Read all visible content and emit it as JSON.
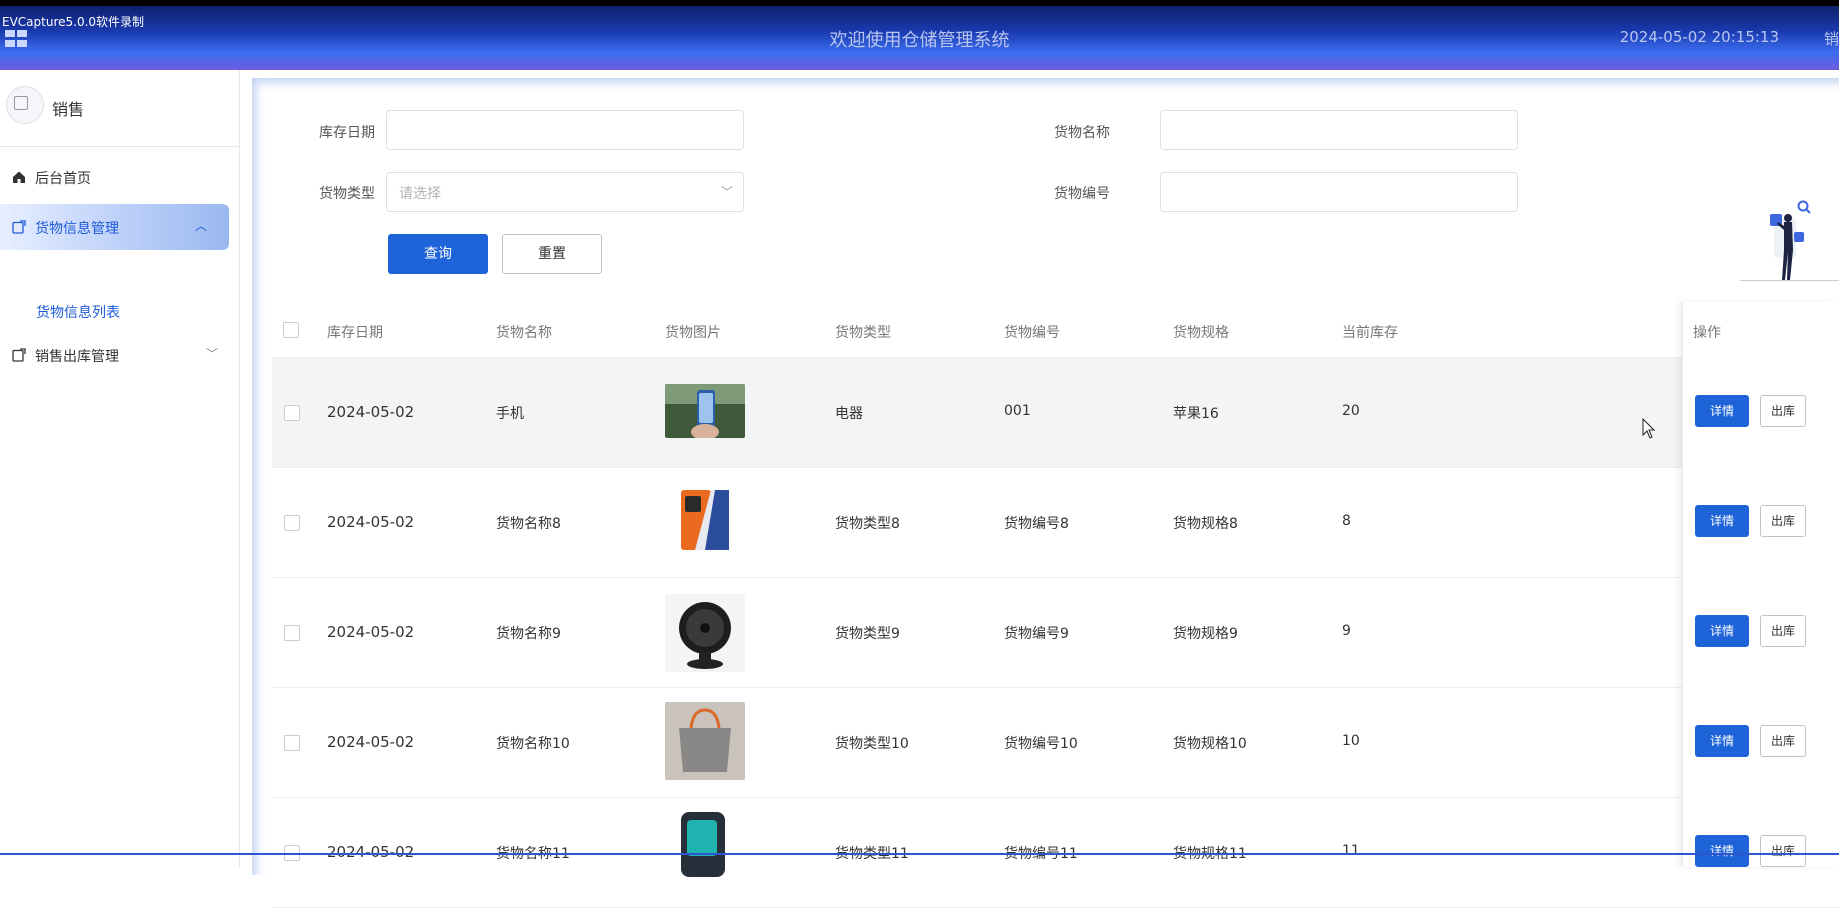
{
  "header": {
    "recorder_label": "EVCapture5.0.0软件录制",
    "title": "欢迎使用仓储管理系统",
    "datetime": "2024-05-02 20:15:13",
    "extra": "销"
  },
  "sidebar": {
    "username": "销售",
    "items": [
      {
        "label": "后台首页",
        "icon": "home-icon"
      },
      {
        "label": "货物信息管理",
        "icon": "edit-icon",
        "expanded": true
      },
      {
        "label": "销售出库管理",
        "icon": "edit-icon",
        "expanded": false
      }
    ],
    "submenu": {
      "label": "货物信息列表"
    }
  },
  "search": {
    "date_label": "库存日期",
    "date_value": "",
    "name_label": "货物名称",
    "name_value": "",
    "type_label": "货物类型",
    "type_placeholder": "请选择",
    "code_label": "货物编号",
    "code_value": "",
    "query_button": "查询",
    "reset_button": "重置"
  },
  "table": {
    "columns": [
      "库存日期",
      "货物名称",
      "货物图片",
      "货物类型",
      "货物编号",
      "货物规格",
      "当前库存",
      "操作"
    ],
    "rows": [
      {
        "date": "2024-05-02",
        "name": "手机",
        "image": "phone-photo",
        "type": "电器",
        "code": "001",
        "spec": "苹果16",
        "stock": "20"
      },
      {
        "date": "2024-05-02",
        "name": "货物名称8",
        "image": "orange-phone-photo",
        "type": "货物类型8",
        "code": "货物编号8",
        "spec": "货物规格8",
        "stock": "8"
      },
      {
        "date": "2024-05-02",
        "name": "货物名称9",
        "image": "fan-photo",
        "type": "货物类型9",
        "code": "货物编号9",
        "spec": "货物规格9",
        "stock": "9"
      },
      {
        "date": "2024-05-02",
        "name": "货物名称10",
        "image": "bag-photo",
        "type": "货物类型10",
        "code": "货物编号10",
        "spec": "货物规格10",
        "stock": "10"
      },
      {
        "date": "2024-05-02",
        "name": "货物名称11",
        "image": "device-photo",
        "type": "货物类型11",
        "code": "货物编号11",
        "spec": "货物规格11",
        "stock": "11"
      }
    ],
    "detail_button": "详情",
    "outbound_button": "出库"
  },
  "colors": {
    "primary": "#1e64d8",
    "header_dark": "#0c1a5c",
    "header_accent": "#6e5ce0"
  }
}
